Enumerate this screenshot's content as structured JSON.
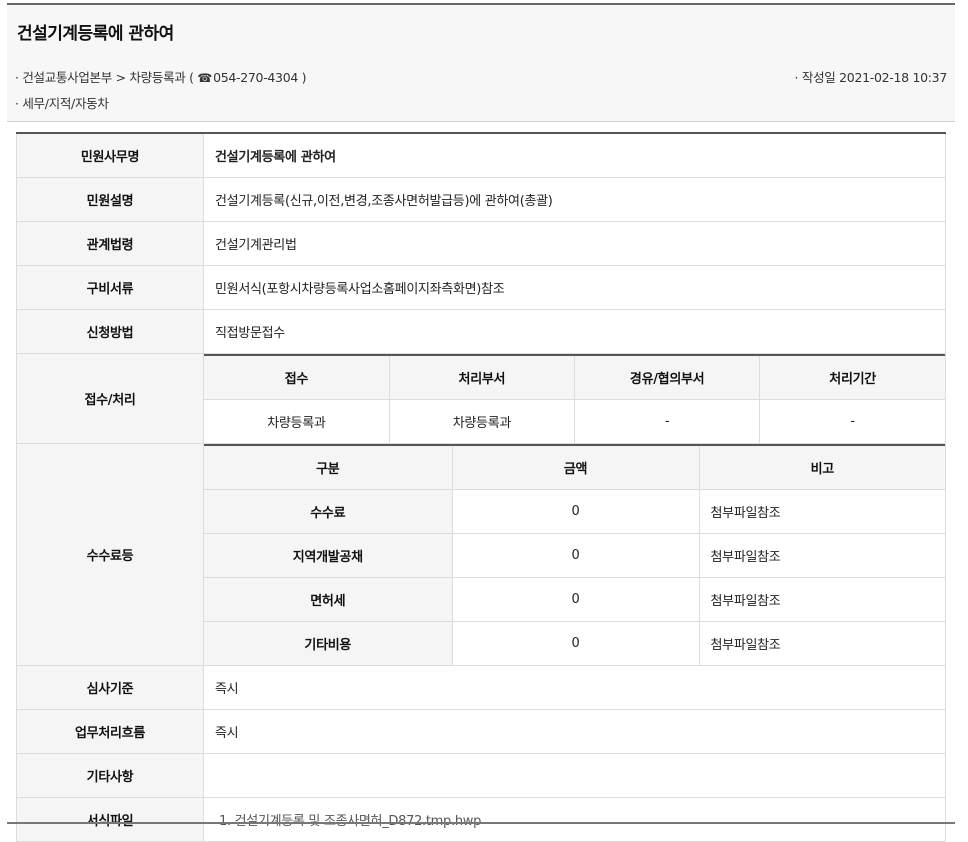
{
  "header": {
    "title": "건설기계등록에 관하여",
    "dept_prefix": "· 건설교통사업본부 > 차량등록과 ( ",
    "phone_icon": "☎",
    "phone": "054-270-4304 )",
    "category": "· 세무/지적/자동차",
    "date_label": "· 작성일 2021-02-18 10:37"
  },
  "rows": {
    "name": {
      "label": "민원사무명",
      "value": "건설기계등록에 관하여"
    },
    "desc": {
      "label": "민원설명",
      "value": "건설기계등록(신규,이전,변경,조종사면허발급등)에 관하여(총괄)"
    },
    "law": {
      "label": "관계법령",
      "value": "건설기계관리법"
    },
    "docs": {
      "label": "구비서류",
      "value": "민원서식(포항시차량등록사업소홈페이지좌측화면)참조"
    },
    "method": {
      "label": "신청방법",
      "value": "직접방문접수"
    },
    "process": {
      "label": "접수/처리",
      "headers": [
        "접수",
        "처리부서",
        "경유/협의부서",
        "처리기간"
      ],
      "values": [
        "차량등록과",
        "차량등록과",
        "-",
        "-"
      ]
    },
    "fees": {
      "label": "수수료등",
      "headers": [
        "구분",
        "금액",
        "비고"
      ],
      "items": [
        {
          "name": "수수료",
          "amount": "0",
          "note": "첨부파일참조"
        },
        {
          "name": "지역개발공채",
          "amount": "0",
          "note": "첨부파일참조"
        },
        {
          "name": "면허세",
          "amount": "0",
          "note": "첨부파일참조"
        },
        {
          "name": "기타비용",
          "amount": "0",
          "note": "첨부파일참조"
        }
      ]
    },
    "review": {
      "label": "심사기준",
      "value": "즉시"
    },
    "flow": {
      "label": "업무처리흐름",
      "value": "즉시"
    },
    "etc": {
      "label": "기타사항",
      "value": ""
    },
    "forms": {
      "label": "서식파일",
      "file": "1. 건설기계등록 및 조종사면허_D872.tmp.hwp"
    }
  }
}
